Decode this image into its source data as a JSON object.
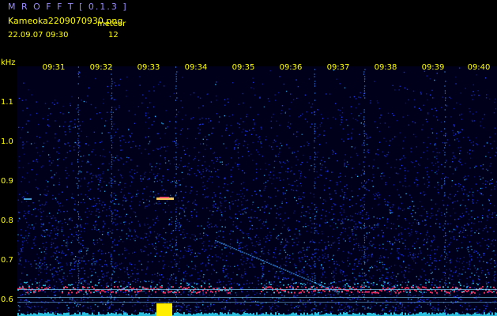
{
  "app_title": "M R O F F T [ 0.1.3 ]",
  "file_name": "Kameoka2209070930.png",
  "meteor_label": "meteor",
  "timestamp": "22.09.07 09:30",
  "meteor_count": "12",
  "y_unit": "kHz",
  "y_ticks": [
    "1.1",
    "1.0",
    "0.9",
    "0.8",
    "0.7",
    "0.6"
  ],
  "x_ticks": [
    "09:31",
    "09:32",
    "09:33",
    "09:34",
    "09:35",
    "09:36",
    "09:37",
    "09:38",
    "09:39",
    "09:40"
  ],
  "colors": {
    "background": "#000000",
    "text": "#ffff00",
    "title": "#9a8cff",
    "noise": "#1a2cff",
    "carrier": "#ff3060"
  }
}
